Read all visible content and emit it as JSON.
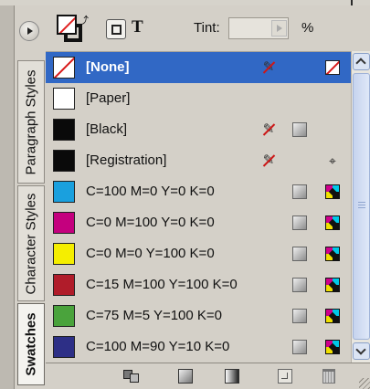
{
  "panel": {
    "tabs": [
      {
        "label": "Paragraph Styles",
        "active": false
      },
      {
        "label": "Character Styles",
        "active": false
      },
      {
        "label": "Swatches",
        "active": true
      }
    ]
  },
  "toolbar": {
    "text_mode_label": "T",
    "tint_label": "Tint:",
    "tint_value": "",
    "percent_sign": "%"
  },
  "swatches": [
    {
      "name": "[None]",
      "color": "none",
      "selected": true,
      "icons": [
        "not-editable-icon",
        "none-type-icon"
      ]
    },
    {
      "name": "[Paper]",
      "color": "#ffffff",
      "selected": false,
      "icons": []
    },
    {
      "name": "[Black]",
      "color": "#0a0a0a",
      "selected": false,
      "icons": [
        "not-editable-icon",
        "process-color-icon"
      ]
    },
    {
      "name": "[Registration]",
      "color": "#0a0a0a",
      "selected": false,
      "icons": [
        "not-editable-icon",
        "registration-icon"
      ]
    },
    {
      "name": "C=100 M=0 Y=0 K=0",
      "color": "#1aa0de",
      "selected": false,
      "icons": [
        "process-color-icon",
        "cmyk-icon"
      ]
    },
    {
      "name": "C=0 M=100 Y=0 K=0",
      "color": "#c4007e",
      "selected": false,
      "icons": [
        "process-color-icon",
        "cmyk-icon"
      ]
    },
    {
      "name": "C=0 M=0 Y=100 K=0",
      "color": "#f5ee00",
      "selected": false,
      "icons": [
        "process-color-icon",
        "cmyk-icon"
      ]
    },
    {
      "name": "C=15 M=100 Y=100 K=0",
      "color": "#b01c2a",
      "selected": false,
      "icons": [
        "process-color-icon",
        "cmyk-icon"
      ]
    },
    {
      "name": "C=75 M=5 Y=100 K=0",
      "color": "#4aa33c",
      "selected": false,
      "icons": [
        "process-color-icon",
        "cmyk-icon"
      ]
    },
    {
      "name": "C=100 M=90 Y=10 K=0",
      "color": "#2d2f86",
      "selected": false,
      "icons": [
        "process-color-icon",
        "cmyk-icon"
      ]
    }
  ],
  "footer": {
    "buttons": [
      "show-all-swatches-icon",
      "show-color-swatches-icon",
      "show-gradient-swatches-icon",
      "new-swatch-icon",
      "delete-swatch-icon"
    ]
  }
}
